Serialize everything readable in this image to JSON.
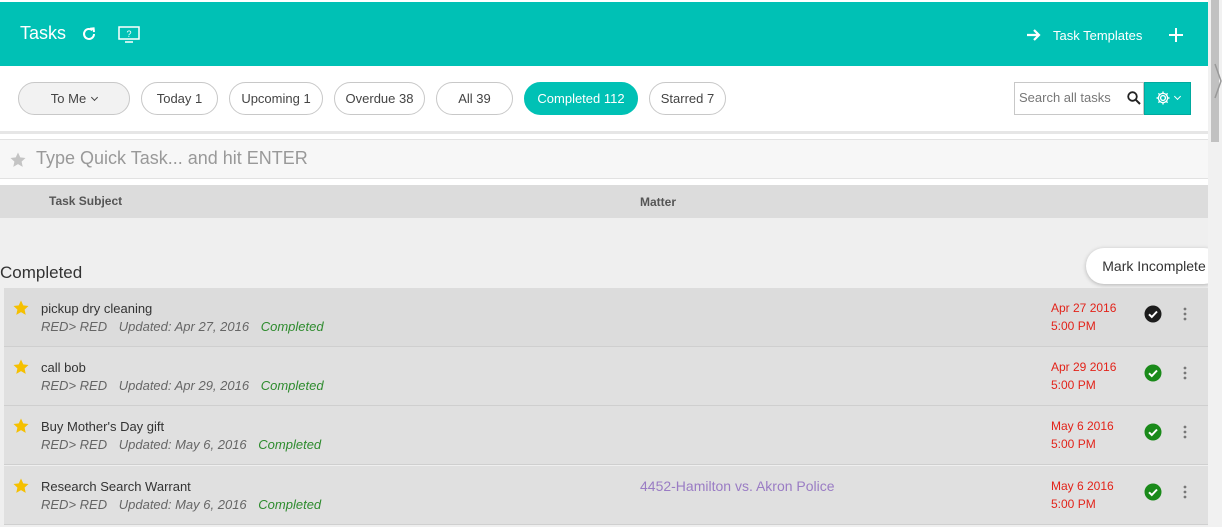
{
  "header": {
    "title": "Tasks",
    "templates_label": "Task Templates",
    "icons": [
      "refresh-icon",
      "help-icon",
      "arrow-right-icon",
      "plus-icon"
    ]
  },
  "filters": {
    "to_me": "To Me",
    "today": "Today 1",
    "upcoming": "Upcoming 1",
    "overdue": "Overdue 38",
    "all": "All 39",
    "completed": "Completed 112",
    "starred": "Starred 7"
  },
  "search": {
    "placeholder": "Search all tasks",
    "value": ""
  },
  "quick_task": {
    "placeholder": "Type Quick Task... and hit ENTER"
  },
  "columns": {
    "subject": "Task Subject",
    "matter": "Matter"
  },
  "section_title": "Completed",
  "tooltip": "Mark Incomplete",
  "tasks": [
    {
      "title": "pickup dry cleaning",
      "assign": "RED> RED",
      "updated": "Updated: Apr 27, 2016",
      "status": "Completed",
      "matter": "",
      "date": "Apr 27 2016",
      "time": "5:00 PM"
    },
    {
      "title": "call bob",
      "assign": "RED> RED",
      "updated": "Updated: Apr 29, 2016",
      "status": "Completed",
      "matter": "",
      "date": "Apr 29 2016",
      "time": "5:00 PM"
    },
    {
      "title": "Buy Mother's Day gift",
      "assign": "RED> RED",
      "updated": "Updated: May 6, 2016",
      "status": "Completed",
      "matter": "",
      "date": "May 6 2016",
      "time": "5:00 PM"
    },
    {
      "title": "Research Search Warrant",
      "assign": "RED> RED",
      "updated": "Updated: May 6, 2016",
      "status": "Completed",
      "matter": "4452-Hamilton vs. Akron Police",
      "date": "May 6 2016",
      "time": "5:00 PM"
    }
  ],
  "colors": {
    "accent": "#00c1b5",
    "date": "#e2231a",
    "status": "#2e8b2e",
    "matter_link": "#9a7cc4",
    "star": "#f5c000"
  }
}
